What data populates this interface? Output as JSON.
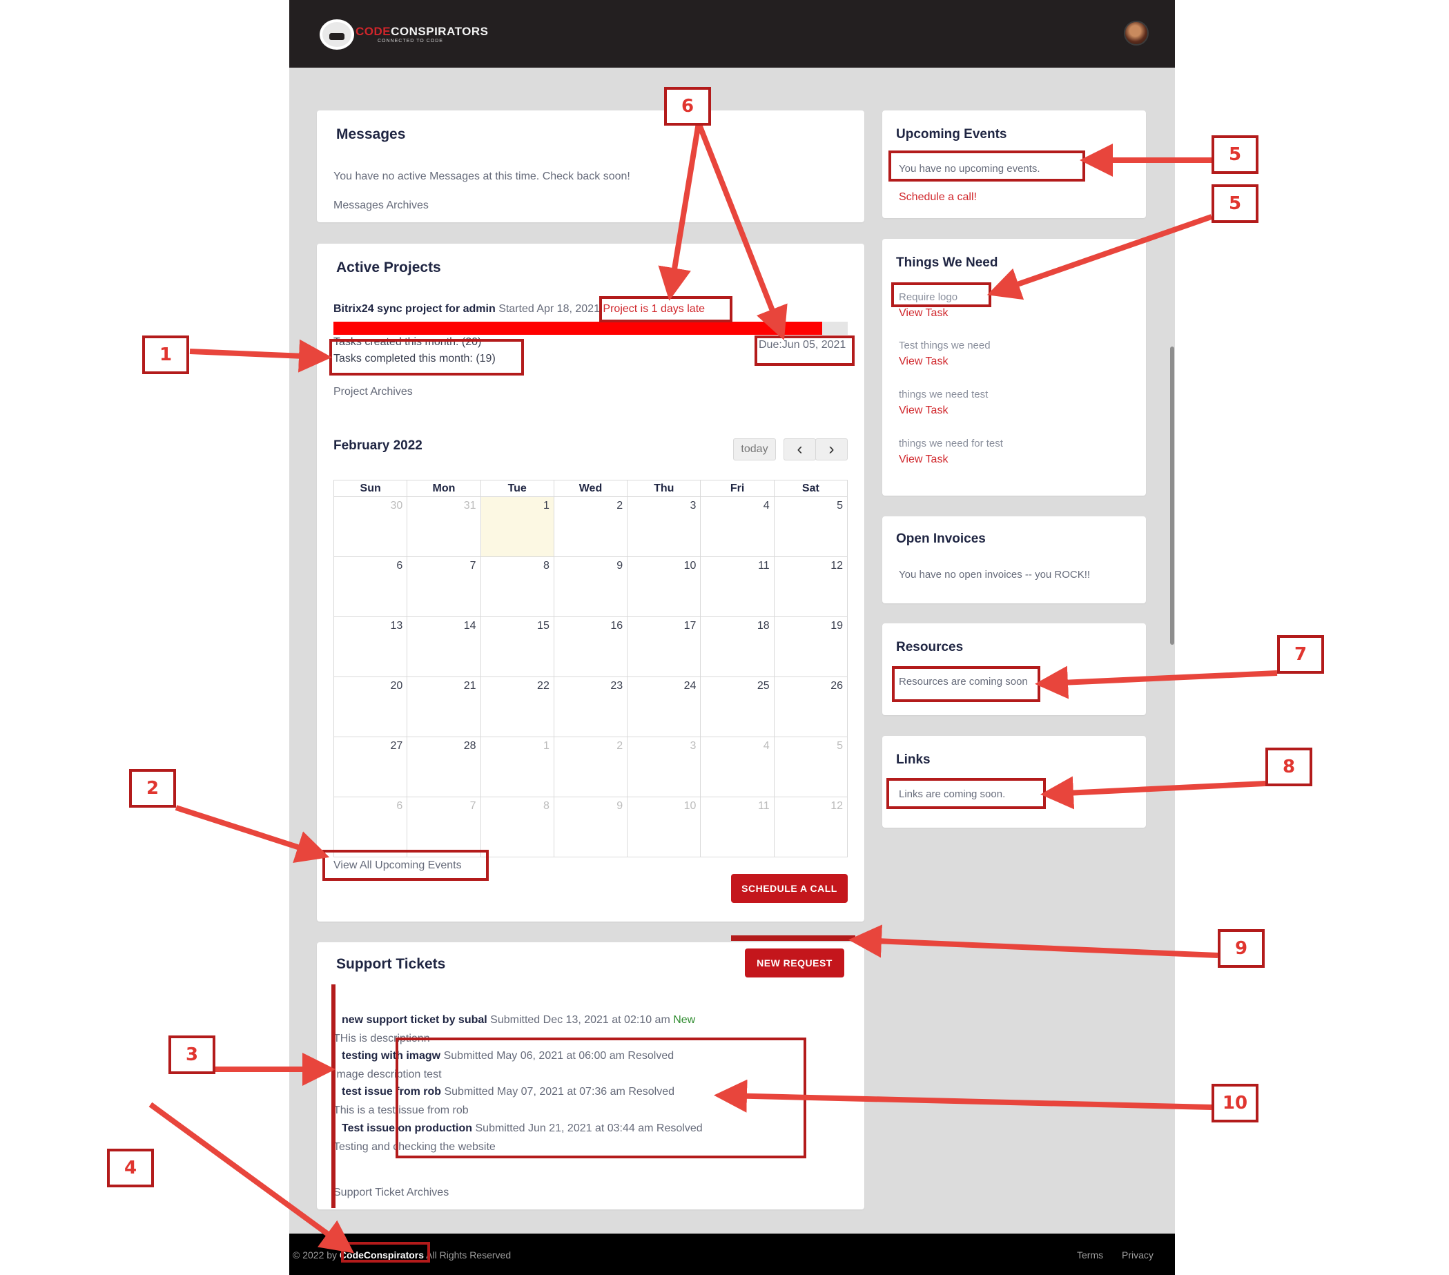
{
  "brand": {
    "code": "CODE",
    "conspirators": "CONSPIRATORS",
    "tagline": "CONNECTED TO CODE"
  },
  "messages": {
    "title": "Messages",
    "empty": "You have no active Messages at this time. Check back soon!",
    "archives": "Messages Archives"
  },
  "projects": {
    "title": "Active Projects",
    "name": "Bitrix24 sync project for admin",
    "started": "Started Apr 18, 2021",
    "late": "Project is 1 days late",
    "progress_percent": 95,
    "created": "Tasks created this month: (20)",
    "completed": "Tasks completed this month: (19)",
    "due": "Due:Jun 05, 2021",
    "archives": "Project Archives"
  },
  "calendar": {
    "month": "February 2022",
    "today_label": "today",
    "prev": "‹",
    "next": "›",
    "days": [
      "Sun",
      "Mon",
      "Tue",
      "Wed",
      "Thu",
      "Fri",
      "Sat"
    ],
    "weeks": [
      [
        {
          "d": "30",
          "o": true
        },
        {
          "d": "31",
          "o": true
        },
        {
          "d": "1",
          "t": true
        },
        {
          "d": "2"
        },
        {
          "d": "3"
        },
        {
          "d": "4"
        },
        {
          "d": "5"
        }
      ],
      [
        {
          "d": "6"
        },
        {
          "d": "7"
        },
        {
          "d": "8"
        },
        {
          "d": "9"
        },
        {
          "d": "10"
        },
        {
          "d": "11"
        },
        {
          "d": "12"
        }
      ],
      [
        {
          "d": "13"
        },
        {
          "d": "14"
        },
        {
          "d": "15"
        },
        {
          "d": "16"
        },
        {
          "d": "17"
        },
        {
          "d": "18"
        },
        {
          "d": "19"
        }
      ],
      [
        {
          "d": "20"
        },
        {
          "d": "21"
        },
        {
          "d": "22"
        },
        {
          "d": "23"
        },
        {
          "d": "24"
        },
        {
          "d": "25"
        },
        {
          "d": "26"
        }
      ],
      [
        {
          "d": "27"
        },
        {
          "d": "28"
        },
        {
          "d": "1",
          "o": true
        },
        {
          "d": "2",
          "o": true
        },
        {
          "d": "3",
          "o": true
        },
        {
          "d": "4",
          "o": true
        },
        {
          "d": "5",
          "o": true
        }
      ],
      [
        {
          "d": "6",
          "o": true
        },
        {
          "d": "7",
          "o": true
        },
        {
          "d": "8",
          "o": true
        },
        {
          "d": "9",
          "o": true
        },
        {
          "d": "10",
          "o": true
        },
        {
          "d": "11",
          "o": true
        },
        {
          "d": "12",
          "o": true
        }
      ]
    ],
    "view_all": "View All Upcoming Events",
    "schedule_button": "SCHEDULE A CALL"
  },
  "tickets": {
    "title": "Support Tickets",
    "new_request": "NEW REQUEST",
    "items": [
      {
        "title": "new support ticket by subal",
        "meta": "Submitted Dec 13, 2021 at 02:10 am",
        "status": "New",
        "desc": "THis is descriptionn"
      },
      {
        "title": "testing with imagw",
        "meta": "Submitted May 06, 2021 at 06:00 am",
        "status": "Resolved",
        "desc": "Image description test"
      },
      {
        "title": "test issue from rob",
        "meta": "Submitted May 07, 2021 at 07:36 am",
        "status": "Resolved",
        "desc": "This is a test issue from rob"
      },
      {
        "title": "Test issue on production",
        "meta": "Submitted Jun 21, 2021 at 03:44 am",
        "status": "Resolved",
        "desc": "Testing and checking the website"
      }
    ],
    "archives": "Support Ticket Archives"
  },
  "events": {
    "title": "Upcoming Events",
    "empty": "You have no upcoming events.",
    "schedule_link": "Schedule a call!"
  },
  "needs": {
    "title": "Things We Need",
    "items": [
      {
        "name": "Require logo",
        "link": "View Task"
      },
      {
        "name": "Test things we need",
        "link": "View Task"
      },
      {
        "name": "things we need test",
        "link": "View Task"
      },
      {
        "name": "things we need for test",
        "link": "View Task"
      }
    ]
  },
  "invoices": {
    "title": "Open Invoices",
    "empty": "You have no open invoices -- you ROCK!!"
  },
  "resources": {
    "title": "Resources",
    "empty": "Resources are coming soon"
  },
  "links": {
    "title": "Links",
    "empty": "Links are coming soon."
  },
  "footer": {
    "copy": "© 2022 by",
    "company": "CodeConspirators",
    "rights": "All Rights Reserved",
    "terms": "Terms",
    "privacy": "Privacy"
  },
  "annotations": [
    "1",
    "2",
    "3",
    "4",
    "5",
    "5",
    "6",
    "7",
    "8",
    "9",
    "10"
  ],
  "colors": {
    "accent": "#d0262b",
    "button": "#c4161c",
    "header": "#231f20",
    "annotation": "#b31b1b",
    "status_new": "#2e8b2e"
  }
}
